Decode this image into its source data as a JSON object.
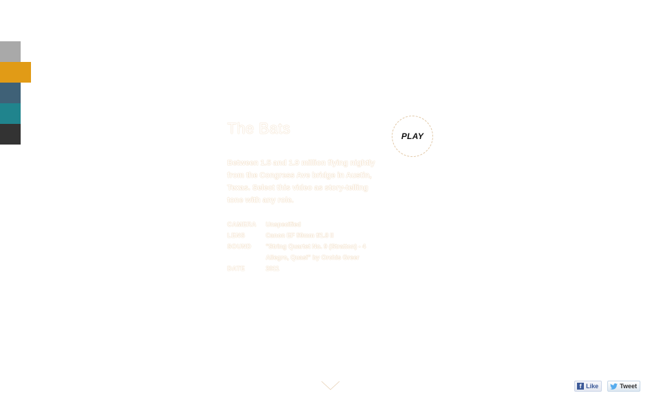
{
  "colors": {
    "swatches": [
      "#ffffff",
      "#a9a9a9",
      "#e19b16",
      "#3f6177",
      "#20848d",
      "#333333"
    ],
    "active_swatch_index": 2,
    "text_outline": "#e8c9a2"
  },
  "video": {
    "title": "The Bats",
    "description": "Between 1.5 and 1.9 million flying nightly from the Congress Ave bridge in Austin, Texas. Select this video as story-telling tone with any role.",
    "meta": [
      {
        "label": "CAMERA",
        "value": "Unspecified"
      },
      {
        "label": "LENS",
        "value": "Canon EF 50mm f/1.8 II"
      },
      {
        "label": "SOUND",
        "value": "\"String Quartet No. 9 (Stratton) - 4 Allegro, Quasi\" by Orchis Greer"
      },
      {
        "label": "DATE",
        "value": "2011"
      }
    ],
    "play_label": "PLAY"
  },
  "social": {
    "like_label": "Like",
    "tweet_label": "Tweet",
    "facebook_color": "#3b5998",
    "twitter_color": "#55acee"
  },
  "icons": {
    "scroll": "chevron-down-icon",
    "facebook": "facebook-icon",
    "twitter": "twitter-bird-icon"
  }
}
